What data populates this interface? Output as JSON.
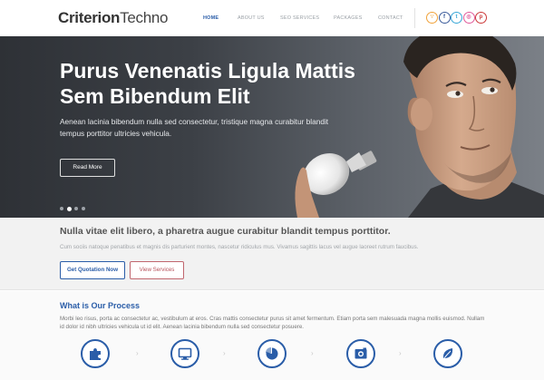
{
  "header": {
    "logo_bold": "Criterion",
    "logo_light": "Techno",
    "nav": [
      "HOME",
      "ABOUT US",
      "SEO SERVICES",
      "PACKAGES",
      "CONTACT"
    ],
    "social": [
      {
        "name": "rss-icon",
        "glyph": "∵",
        "color": "#f0a23a"
      },
      {
        "name": "facebook-icon",
        "glyph": "f",
        "color": "#3b5b9a"
      },
      {
        "name": "twitter-icon",
        "glyph": "t",
        "color": "#3aa8d8"
      },
      {
        "name": "dribbble-icon",
        "glyph": "◎",
        "color": "#e05a9a"
      },
      {
        "name": "pinterest-icon",
        "glyph": "p",
        "color": "#cc3a3a"
      }
    ]
  },
  "hero": {
    "title": "Purus Venenatis Ligula Mattis Sem Bibendum Elit",
    "subtitle": "Aenean lacinia bibendum nulla sed consectetur, tristique magna curabitur blandit tempus porttitor ultricies vehicula.",
    "button": "Read More",
    "active_slide": 1,
    "slide_count": 4
  },
  "cta": {
    "title": "Nulla vitae elit libero, a pharetra augue curabitur blandit tempus porttitor.",
    "subtitle": "Cum sociis natoque penatibus et magnis dis parturient montes, nascetur ridiculus mus. Vivamus sagittis lacus vel augue laoreet rutrum faucibus.",
    "quote_button": "Get Quotation Now",
    "services_button": "View Services"
  },
  "process": {
    "title": "What is Our Process",
    "text": "Morbi leo risus, porta ac consectetur ac, vestibulum at eros. Cras mattis consectetur purus sit amet fermentum. Etiam porta sem malesuada magna mollis euismod. Nullam id dolor id nibh ultricies vehicula ut id elit. Aenean lacinia bibendum nulla sed consectetur posuere.",
    "steps": [
      "puzzle-icon",
      "monitor-icon",
      "pie-chart-icon",
      "photo-icon",
      "leaf-icon"
    ],
    "arrow": "›"
  },
  "colors": {
    "brand_blue": "#2a5da8",
    "accent_red": "#b7515a"
  }
}
